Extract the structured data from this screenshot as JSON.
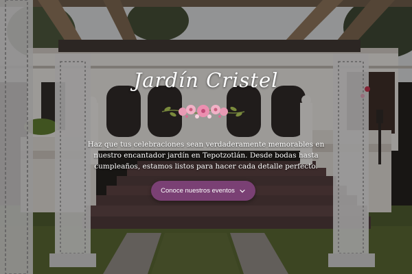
{
  "hero": {
    "title": "Jardín Cristel",
    "description": "Haz que tus celebraciones sean verdaderamente memorables en nuestro encantador jardín en Tepotzotlán. Desde bodas hasta cumpleaños, estamos listos para hacer cada detalle perfecto.",
    "cta_label": "Conoce nuestros eventos",
    "cta_icon": "chevron-down-icon",
    "ornament_icon": "floral-ornament-icon",
    "colors": {
      "accent": "#7a4074",
      "text": "#ffffff",
      "lawn": "#4a5a2c",
      "building": "#e8e6e2"
    }
  }
}
